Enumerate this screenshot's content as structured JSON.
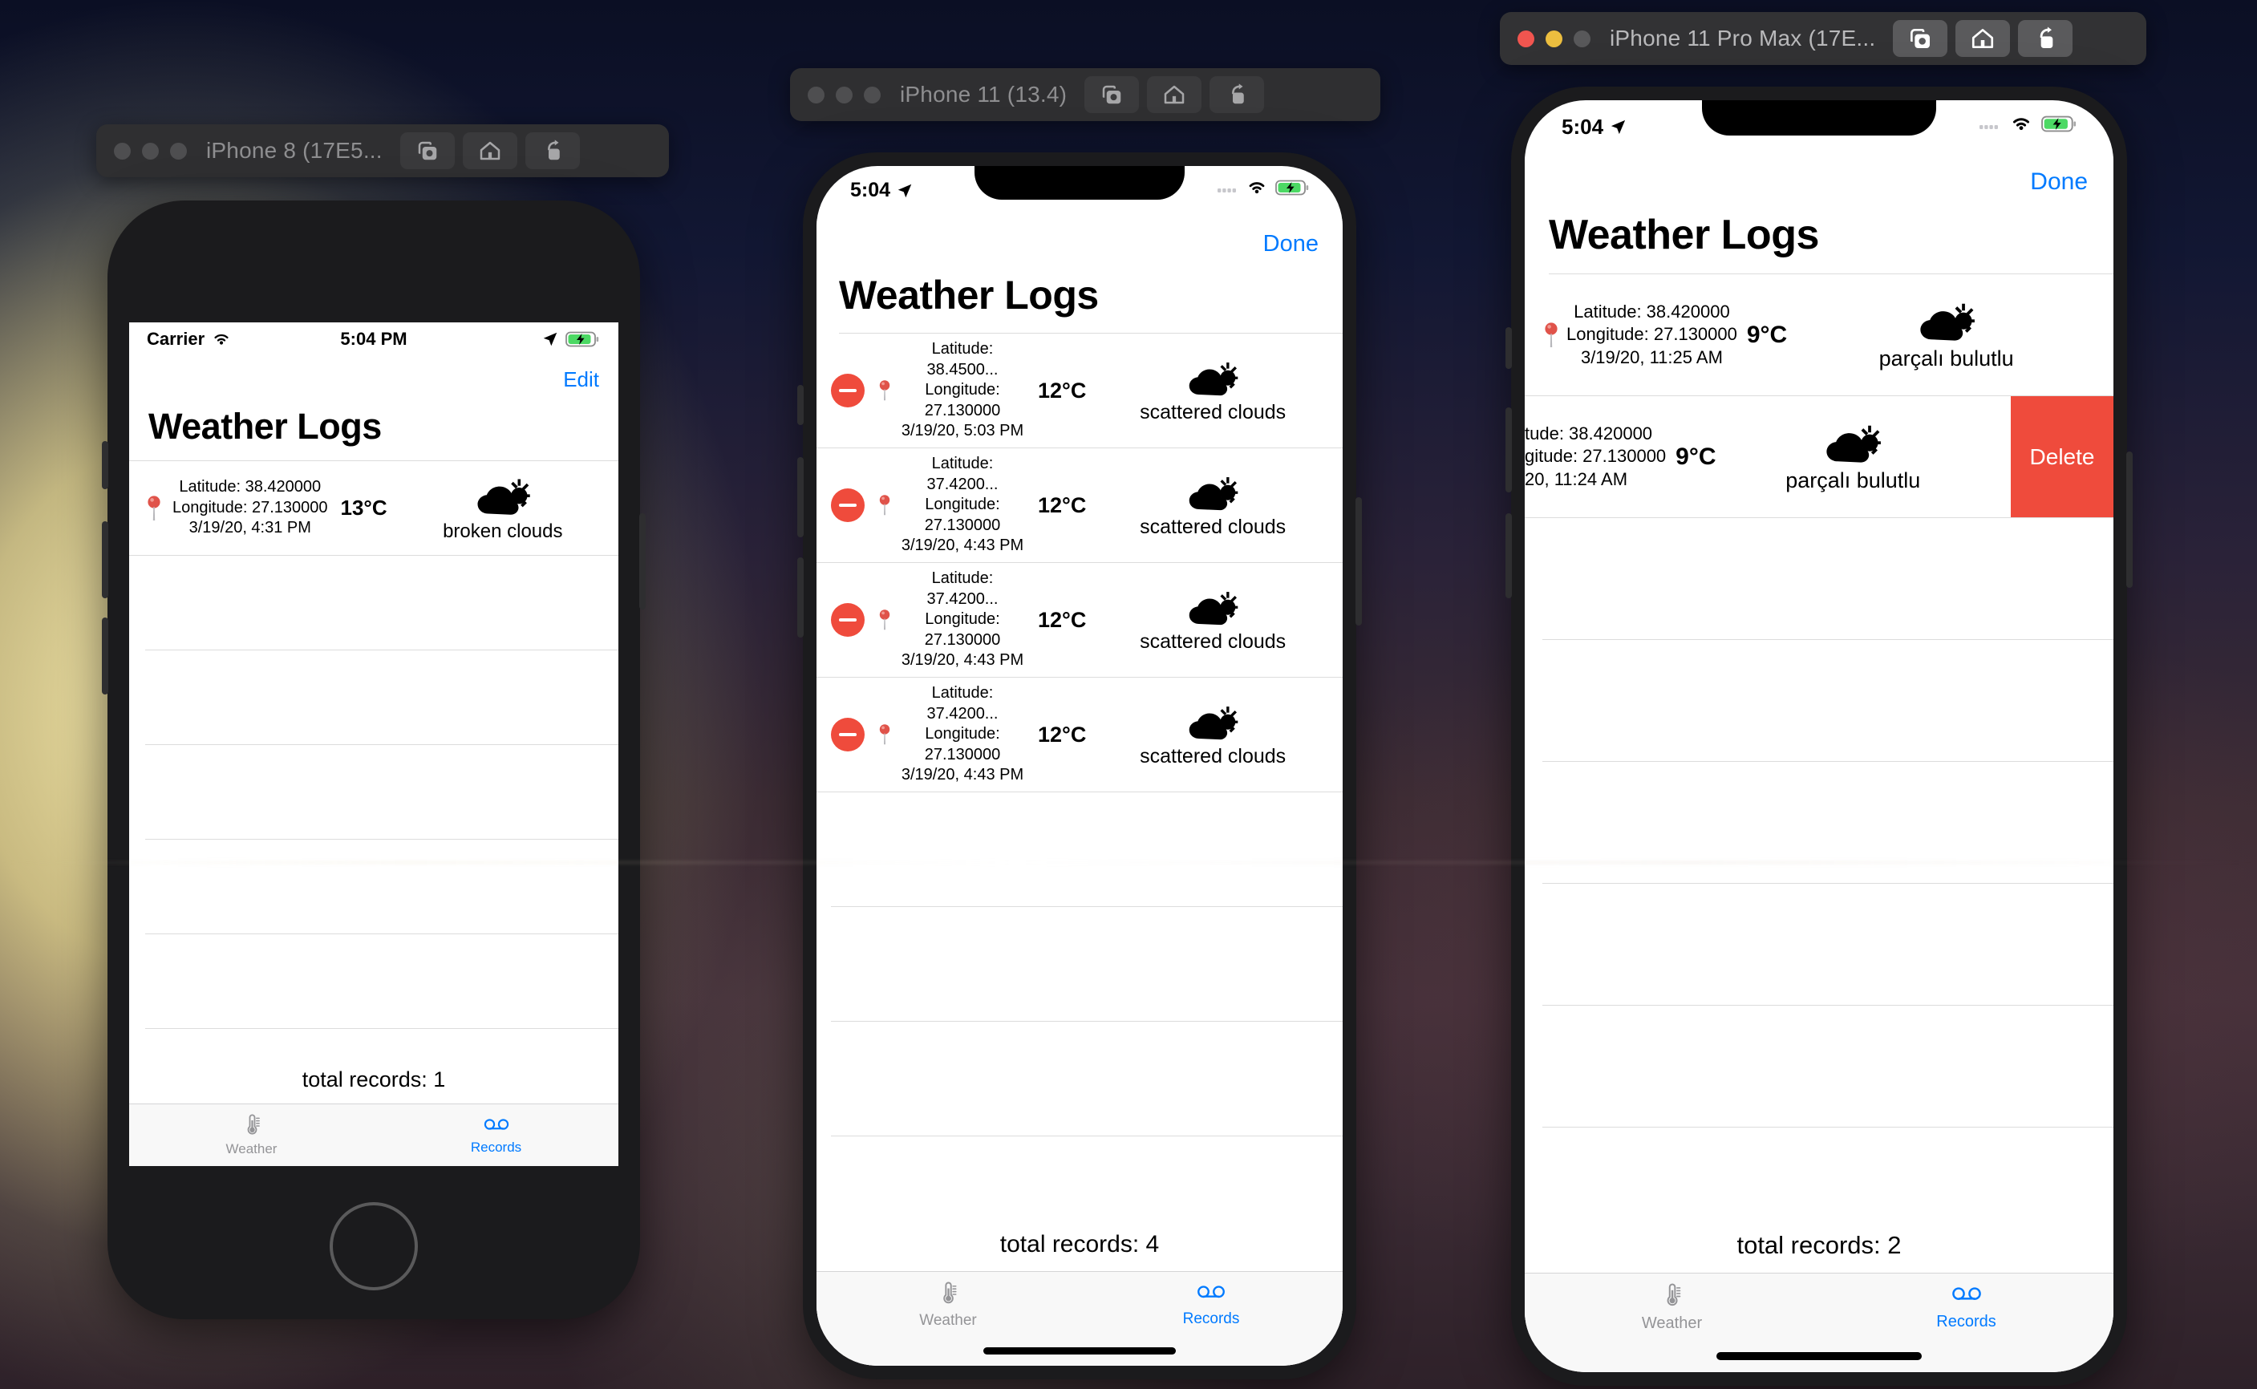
{
  "windows": {
    "iphone8": {
      "title": "iPhone 8 (17E5...",
      "active": false
    },
    "iphone11": {
      "title": "iPhone 11 (13.4)",
      "active": false
    },
    "iphone11promax": {
      "title": "iPhone 11 Pro Max (17E...",
      "active": true
    }
  },
  "toolbar": {
    "screenshot_label": "screenshot-icon",
    "home_label": "home-icon",
    "share_label": "share-icon"
  },
  "colors": {
    "accent_blue": "#007aff",
    "destructive_red": "#ef4b3c",
    "battery_green": "#4cd964",
    "separator": "#dcdcdc",
    "tabbar_bg": "#f8f8f8",
    "inactive_tab": "#949497"
  },
  "phone8": {
    "status": {
      "carrier": "Carrier",
      "time": "5:04 PM",
      "wifi_icon": "wifi-icon",
      "location_icon": "location-arrow-icon",
      "battery_icon": "battery-charging-icon"
    },
    "nav": {
      "action_label": "Edit"
    },
    "title": "Weather Logs",
    "rows": [
      {
        "pin_icon": "map-pin-icon",
        "latitude": "Latitude: 38.420000",
        "longitude": "Longitude: 27.130000",
        "timestamp": "3/19/20, 4:31 PM",
        "temperature": "13°C",
        "weather_icon": "cloud-sun-icon",
        "description": "broken clouds"
      }
    ],
    "empty_row_count": 5,
    "footer": "total records: 1",
    "tabs": [
      {
        "label": "Weather",
        "icon": "thermometer-icon",
        "active": false
      },
      {
        "label": "Records",
        "icon": "voicemail-icon",
        "active": true
      }
    ]
  },
  "phone11": {
    "status": {
      "time": "5:04",
      "location_icon": "location-arrow-icon",
      "cellular_icon": "cellular-bars-icon",
      "wifi_icon": "wifi-icon",
      "battery_icon": "battery-charging-icon"
    },
    "nav": {
      "action_label": "Done"
    },
    "title": "Weather Logs",
    "editing": true,
    "rows": [
      {
        "delete_toggle_icon": "minus-circle-icon",
        "pin_icon": "map-pin-icon",
        "latitude": "Latitude: 38.4500...",
        "longitude_label": "Longitude:",
        "longitude_value": "27.130000",
        "timestamp": "3/19/20, 5:03 PM",
        "temperature": "12°C",
        "weather_icon": "cloud-sun-icon",
        "description": "scattered clouds"
      },
      {
        "delete_toggle_icon": "minus-circle-icon",
        "pin_icon": "map-pin-icon",
        "latitude": "Latitude: 37.4200...",
        "longitude_label": "Longitude:",
        "longitude_value": "27.130000",
        "timestamp": "3/19/20, 4:43 PM",
        "temperature": "12°C",
        "weather_icon": "cloud-sun-icon",
        "description": "scattered clouds"
      },
      {
        "delete_toggle_icon": "minus-circle-icon",
        "pin_icon": "map-pin-icon",
        "latitude": "Latitude: 37.4200...",
        "longitude_label": "Longitude:",
        "longitude_value": "27.130000",
        "timestamp": "3/19/20, 4:43 PM",
        "temperature": "12°C",
        "weather_icon": "cloud-sun-icon",
        "description": "scattered clouds"
      },
      {
        "delete_toggle_icon": "minus-circle-icon",
        "pin_icon": "map-pin-icon",
        "latitude": "Latitude: 37.4200...",
        "longitude_label": "Longitude:",
        "longitude_value": "27.130000",
        "timestamp": "3/19/20, 4:43 PM",
        "temperature": "12°C",
        "weather_icon": "cloud-sun-icon",
        "description": "scattered clouds"
      }
    ],
    "empty_row_count": 4,
    "footer": "total records: 4",
    "tabs": [
      {
        "label": "Weather",
        "icon": "thermometer-icon",
        "active": false
      },
      {
        "label": "Records",
        "icon": "voicemail-icon",
        "active": true
      }
    ]
  },
  "phone11promax": {
    "status": {
      "time": "5:04",
      "location_icon": "location-arrow-icon",
      "cellular_icon": "cellular-bars-icon",
      "wifi_icon": "wifi-icon",
      "battery_icon": "battery-charging-icon"
    },
    "nav": {
      "action_label": "Done"
    },
    "title": "Weather Logs",
    "rows": [
      {
        "pin_icon": "map-pin-icon",
        "latitude": "Latitude: 38.420000",
        "longitude": "Longitude: 27.130000",
        "timestamp": "3/19/20, 11:25 AM",
        "temperature": "9°C",
        "weather_icon": "cloud-sun-icon",
        "description": "parçalı bulutlu",
        "swiped": false
      },
      {
        "pin_icon": "map-pin-icon",
        "latitude": "tude: 38.420000",
        "longitude": "gitude: 27.130000",
        "timestamp": "20, 11:24 AM",
        "temperature": "9°C",
        "weather_icon": "cloud-sun-icon",
        "description": "parçalı bulutlu",
        "swiped": true,
        "delete_label": "Delete"
      }
    ],
    "empty_row_count": 5,
    "footer": "total records: 2",
    "tabs": [
      {
        "label": "Weather",
        "icon": "thermometer-icon",
        "active": false
      },
      {
        "label": "Records",
        "icon": "voicemail-icon",
        "active": true
      }
    ]
  }
}
